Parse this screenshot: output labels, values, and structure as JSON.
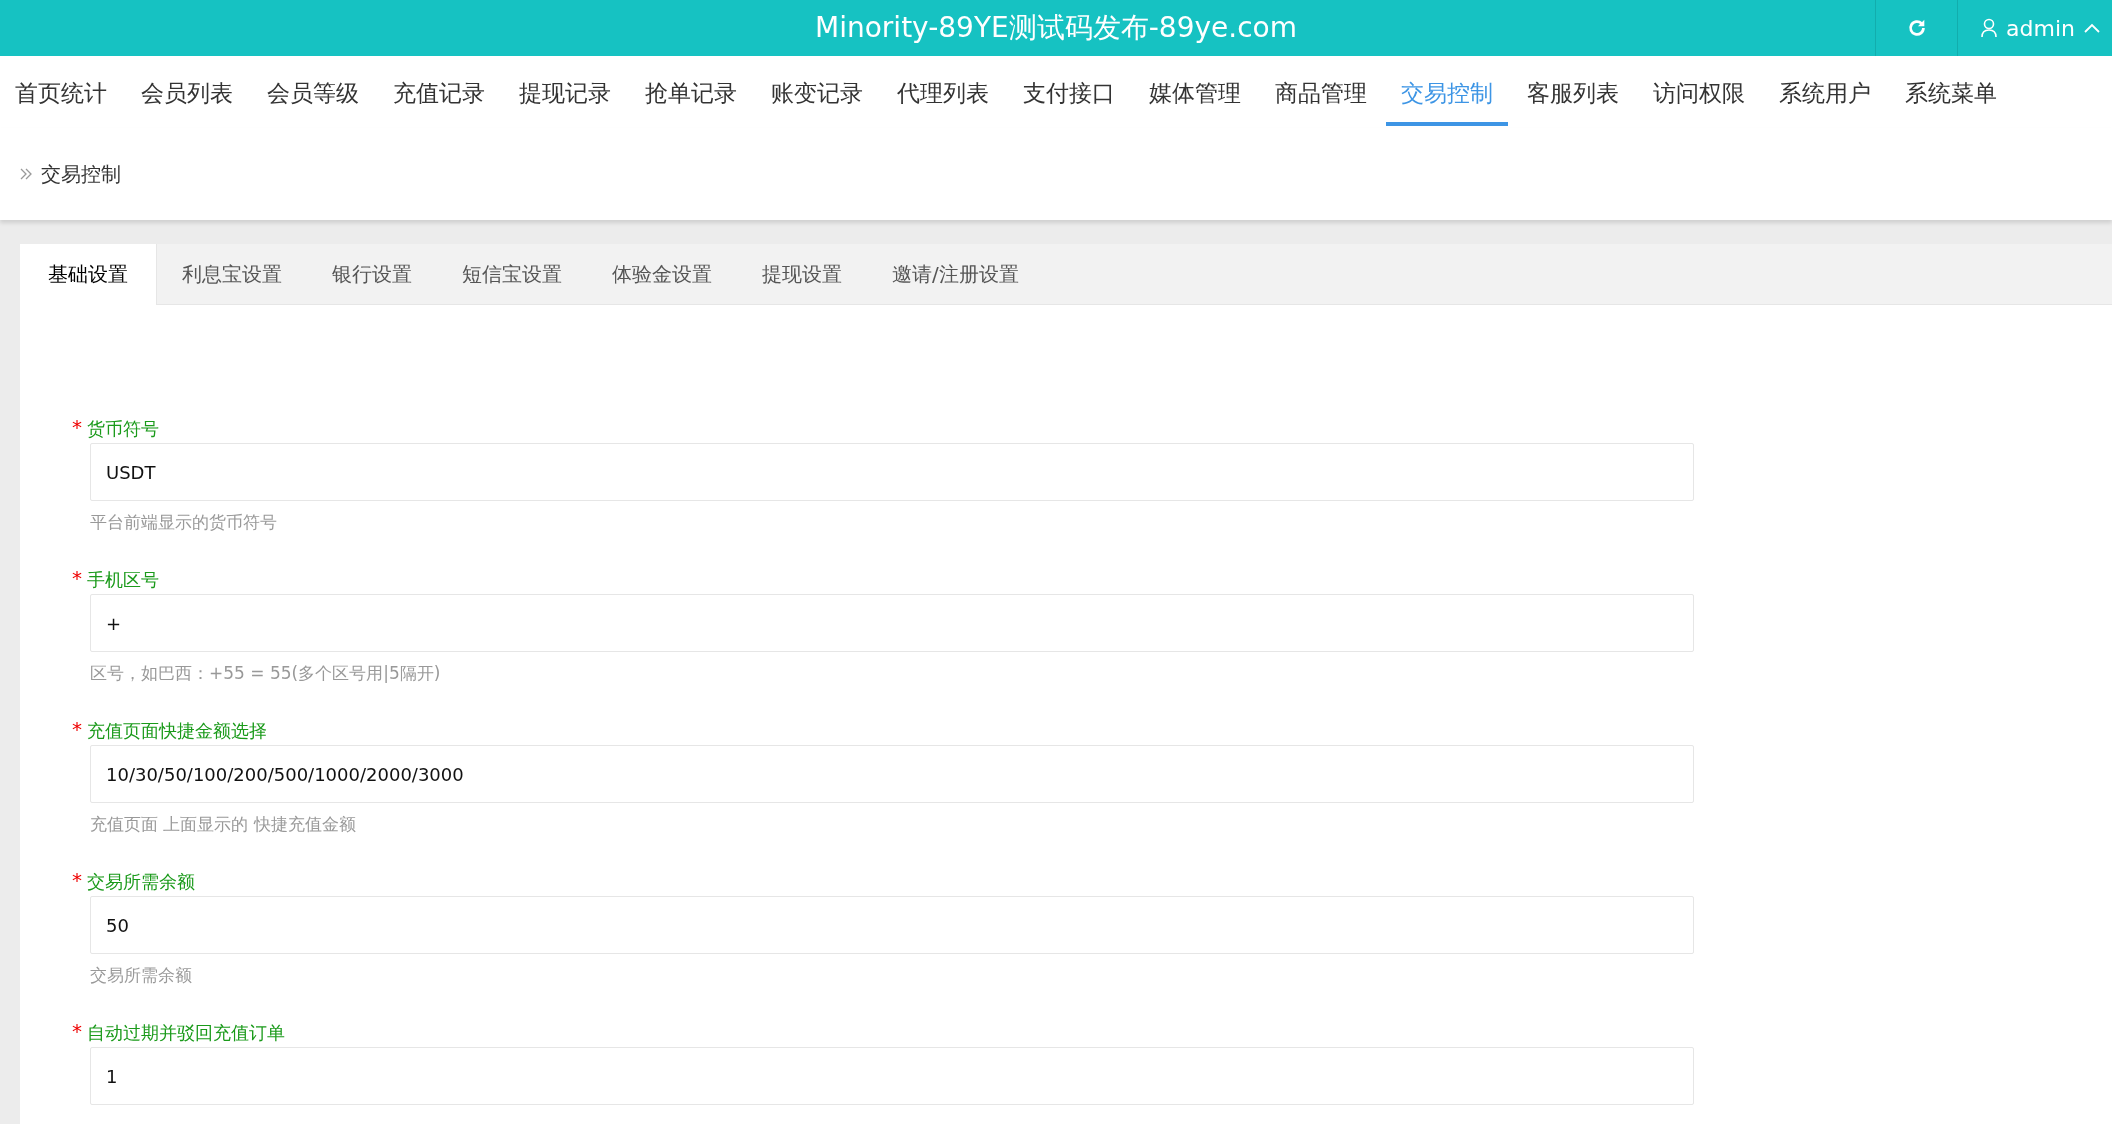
{
  "header": {
    "title": "Minority-89YE测试码发布-89ye.com",
    "user": "admin"
  },
  "nav": [
    {
      "label": "首页统计",
      "selected": false
    },
    {
      "label": "会员列表",
      "selected": false
    },
    {
      "label": "会员等级",
      "selected": false
    },
    {
      "label": "充值记录",
      "selected": false
    },
    {
      "label": "提现记录",
      "selected": false
    },
    {
      "label": "抢单记录",
      "selected": false
    },
    {
      "label": "账变记录",
      "selected": false
    },
    {
      "label": "代理列表",
      "selected": false
    },
    {
      "label": "支付接口",
      "selected": false
    },
    {
      "label": "媒体管理",
      "selected": false
    },
    {
      "label": "商品管理",
      "selected": false
    },
    {
      "label": "交易控制",
      "selected": true
    },
    {
      "label": "客服列表",
      "selected": false
    },
    {
      "label": "访问权限",
      "selected": false
    },
    {
      "label": "系统用户",
      "selected": false
    },
    {
      "label": "系统菜单",
      "selected": false
    }
  ],
  "breadcrumb": "交易控制",
  "tabs": [
    {
      "label": "基础设置",
      "selected": true
    },
    {
      "label": "利息宝设置",
      "selected": false
    },
    {
      "label": "银行设置",
      "selected": false
    },
    {
      "label": "短信宝设置",
      "selected": false
    },
    {
      "label": "体验金设置",
      "selected": false
    },
    {
      "label": "提现设置",
      "selected": false
    },
    {
      "label": "邀请/注册设置",
      "selected": false
    }
  ],
  "fields": [
    {
      "label": "货币符号",
      "mark": "*",
      "value": "USDT",
      "help": "平台前端显示的货币符号"
    },
    {
      "label": "手机区号",
      "mark": "*",
      "value": "+",
      "help": "区号，如巴西：+55 = 55(多个区号用|5隔开)"
    },
    {
      "label": "充值页面快捷金额选择",
      "mark": "*",
      "value": "10/30/50/100/200/500/1000/2000/3000",
      "help": "充值页面 上面显示的 快捷充值金额"
    },
    {
      "label": "交易所需余额",
      "mark": "*",
      "value": "50",
      "help": "交易所需余额"
    },
    {
      "label": "自动过期并驳回充值订单",
      "mark": "*",
      "value": "1"
    }
  ]
}
